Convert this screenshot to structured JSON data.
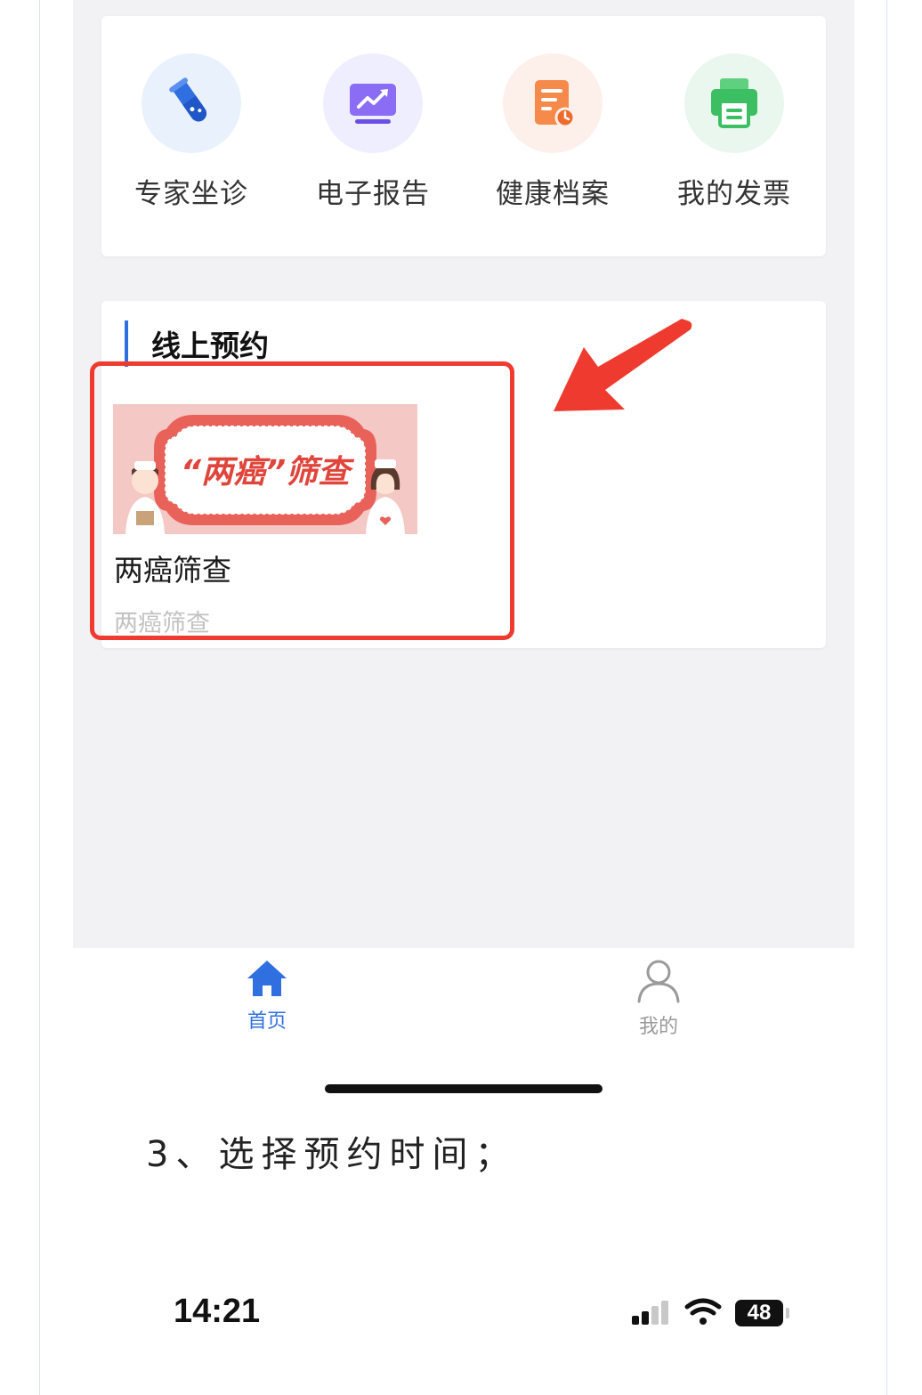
{
  "quick_menu": {
    "items": [
      {
        "label": "专家坐诊",
        "icon": "test-tube-icon",
        "bg": "#e9f1fd",
        "color": "#2f6fe0"
      },
      {
        "label": "电子报告",
        "icon": "chart-report-icon",
        "bg": "#efeefe",
        "color": "#7b5cf0"
      },
      {
        "label": "健康档案",
        "icon": "health-record-icon",
        "bg": "#fdf0ea",
        "color": "#f0783c"
      },
      {
        "label": "我的发票",
        "icon": "invoice-printer-icon",
        "bg": "#eaf7ee",
        "color": "#3cbf62"
      }
    ]
  },
  "booking": {
    "section_title": "线上预约",
    "service": {
      "banner_text": "“两癌”筛查",
      "title": "两癌筛查",
      "subtitle": "两癌筛查"
    }
  },
  "tab_bar": {
    "tabs": [
      {
        "label": "首页",
        "icon": "home-icon",
        "active": true,
        "color": "#2f6fe0"
      },
      {
        "label": "我的",
        "icon": "user-icon",
        "active": false,
        "color": "#9a9a9a"
      }
    ]
  },
  "caption": "3、选择预约时间；",
  "status_bar": {
    "time": "14:21",
    "battery": "48",
    "icons": [
      "signal-icon",
      "wifi-icon",
      "battery-icon"
    ]
  },
  "colors": {
    "accent": "#2f6fe0",
    "annotation": "#ef3b2f"
  }
}
